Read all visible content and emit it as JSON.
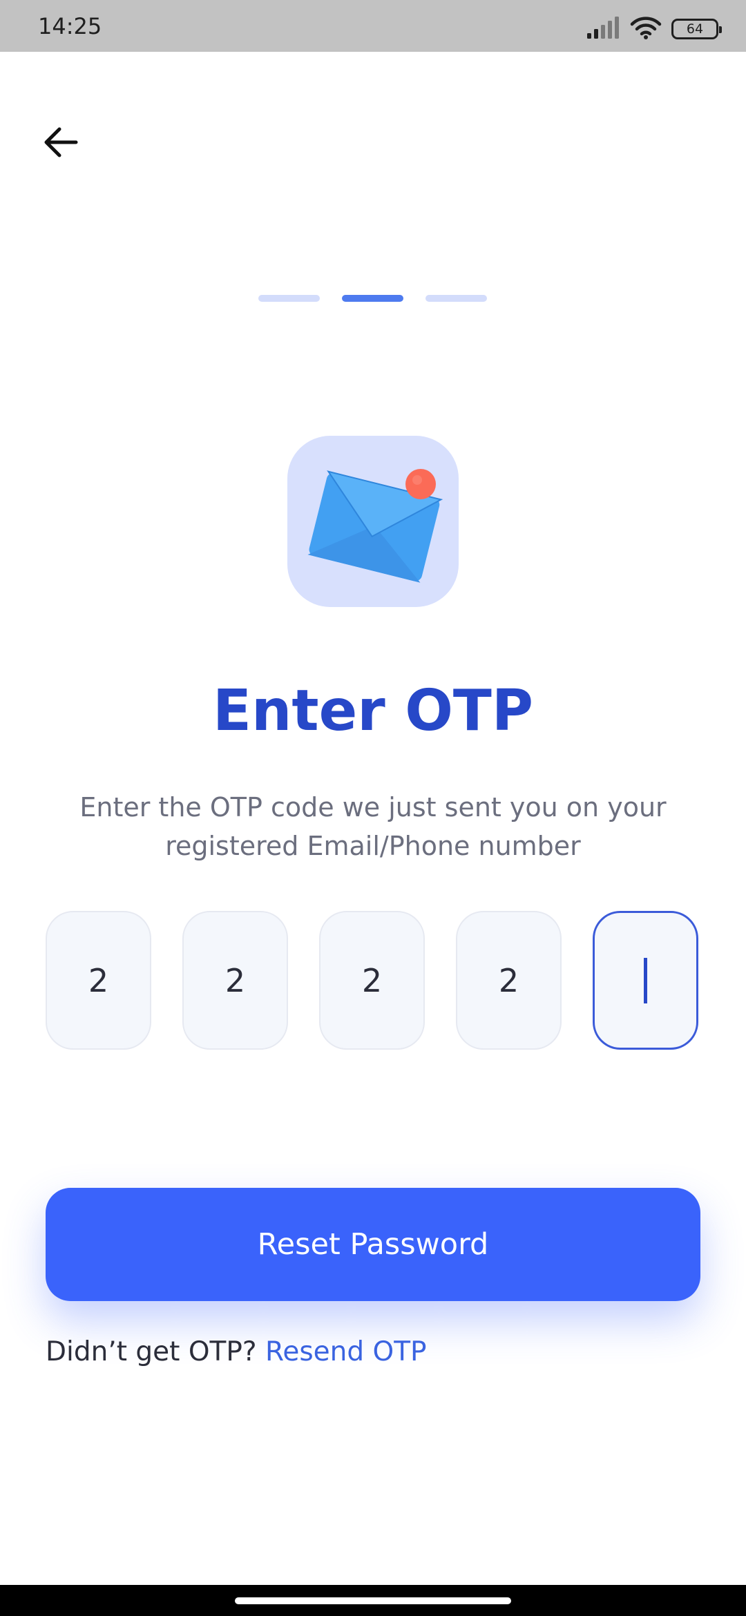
{
  "status_bar": {
    "time": "14:25",
    "battery_level": "64",
    "icons": [
      "signal-icon",
      "wifi-icon",
      "battery-icon"
    ]
  },
  "header": {
    "back_icon": "arrow-left-icon"
  },
  "steps": {
    "total": 3,
    "current": 2
  },
  "hero": {
    "icon": "envelope-notification-icon"
  },
  "title": "Enter OTP",
  "subtitle": "Enter the OTP code we just sent you on your registered Email/Phone number",
  "otp": {
    "digits": [
      "2",
      "2",
      "2",
      "2",
      ""
    ],
    "focused_index": 4
  },
  "actions": {
    "reset_button_label": "Reset Password"
  },
  "resend": {
    "prompt": "Didn’t get OTP? ",
    "link_label": "Resend OTP"
  },
  "colors": {
    "primary": "#3a63fb",
    "title": "#2748c8",
    "step_active": "#4e7bef",
    "step_inactive": "#d3dcfb",
    "tile_background": "#d8e0fd",
    "notification_dot": "#fb6b57"
  }
}
